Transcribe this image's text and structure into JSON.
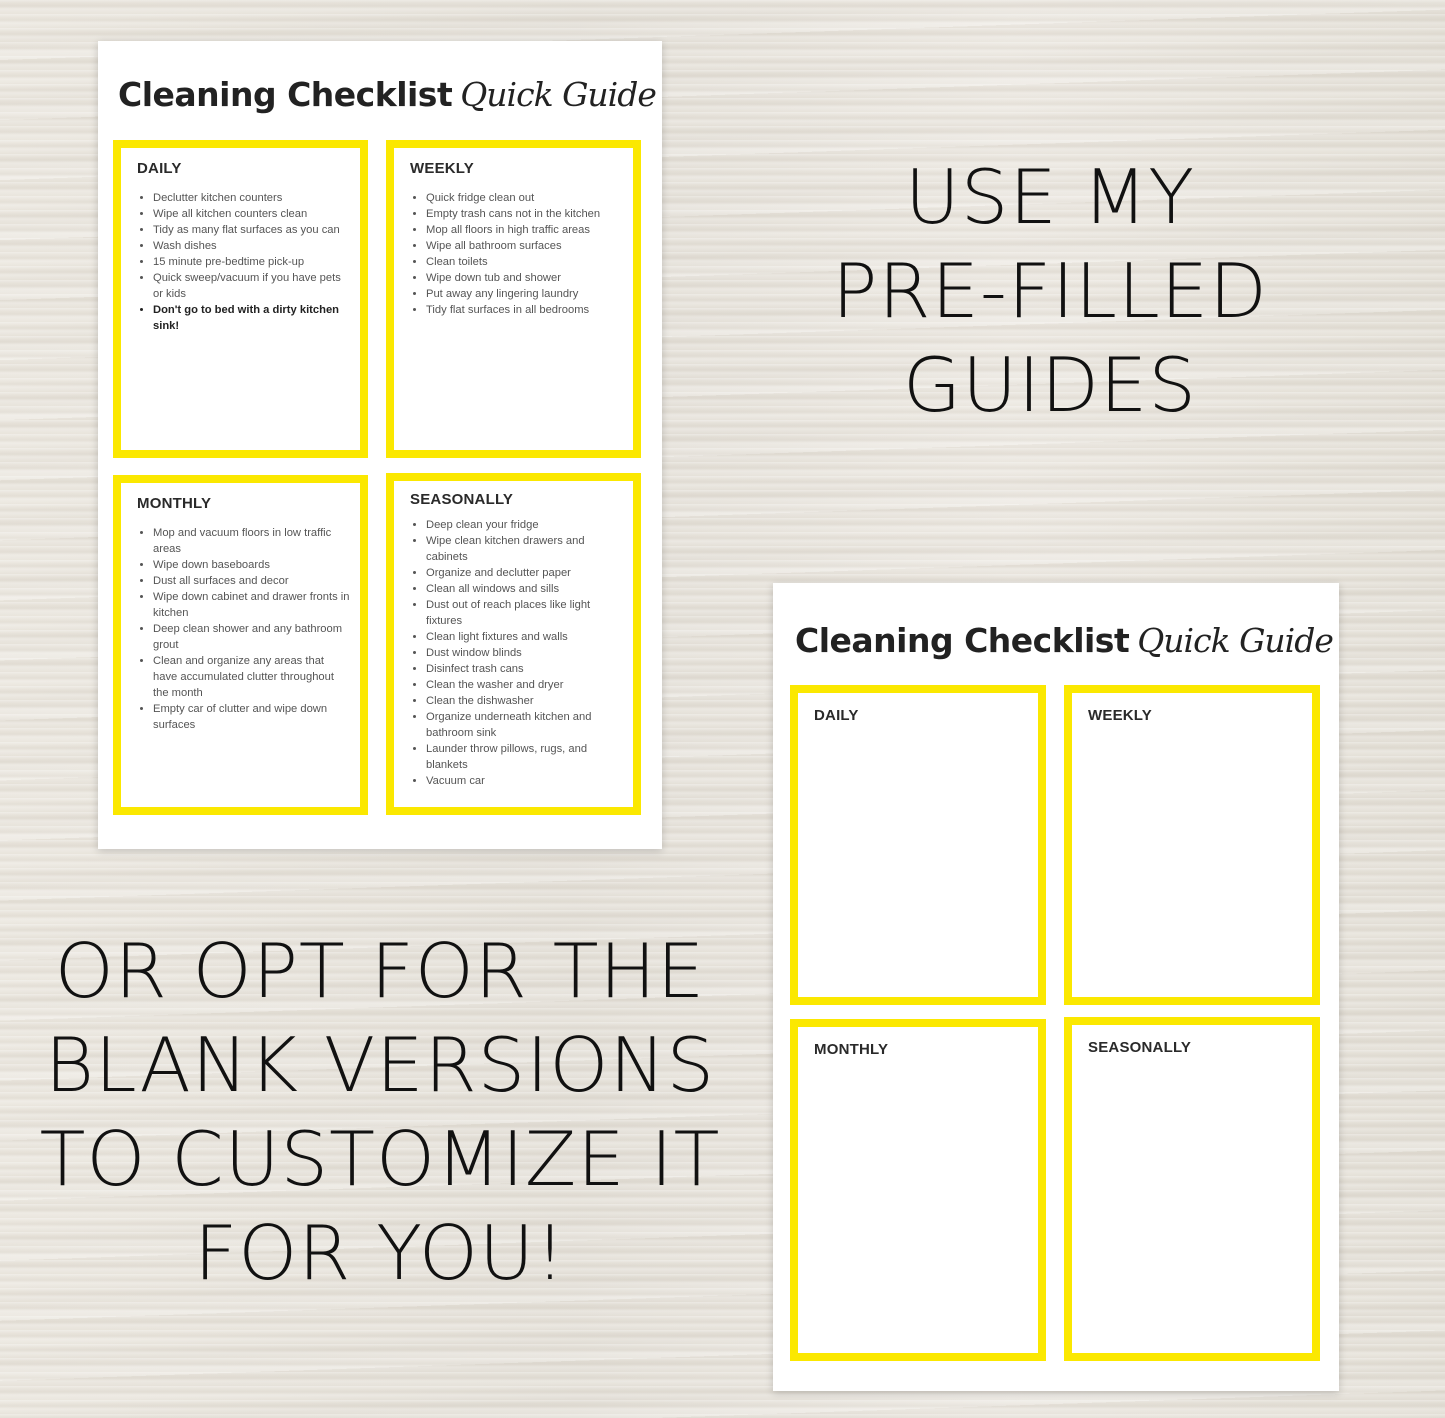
{
  "theme": {
    "accent_yellow": "#fbe800",
    "text_dark": "#222222",
    "text_body": "#555555"
  },
  "filled_sheet": {
    "title_bold": "Cleaning Checklist",
    "title_script": "Quick Guide",
    "sections": [
      {
        "title": "DAILY",
        "items": [
          "Declutter kitchen counters",
          "Wipe all kitchen counters clean",
          "Tidy as many flat surfaces as you can",
          "Wash dishes",
          "15 minute pre-bedtime pick-up",
          "Quick sweep/vacuum if you have pets or kids",
          "Don't go to bed with a dirty kitchen sink!"
        ]
      },
      {
        "title": "WEEKLY",
        "items": [
          "Quick fridge clean out",
          "Empty trash cans not in the kitchen",
          "Mop all floors in high traffic areas",
          "Wipe all bathroom surfaces",
          "Clean toilets",
          "Wipe down tub and shower",
          "Put away any lingering laundry",
          "Tidy flat surfaces in all bedrooms"
        ]
      },
      {
        "title": "MONTHLY",
        "items": [
          "Mop and vacuum floors in low traffic areas",
          "Wipe down baseboards",
          "Dust all surfaces and decor",
          "Wipe down cabinet and drawer fronts in kitchen",
          "Deep clean shower and any bathroom grout",
          "Clean and organize any areas that have accumulated clutter throughout the month",
          "Empty car of clutter and wipe down surfaces"
        ]
      },
      {
        "title": "SEASONALLY",
        "items": [
          "Deep clean your fridge",
          "Wipe clean kitchen drawers and cabinets",
          "Organize and declutter paper",
          "Clean all windows and sills",
          "Dust out of reach places like light fixtures",
          "Clean light fixtures and walls",
          "Dust window blinds",
          "Disinfect trash cans",
          "Clean the washer and dryer",
          "Clean the dishwasher",
          "Organize underneath kitchen and bathroom sink",
          "Launder throw pillows, rugs, and blankets",
          "Vacuum car"
        ]
      }
    ]
  },
  "blank_sheet": {
    "title_bold": "Cleaning Checklist",
    "title_script": "Quick Guide",
    "sections": [
      {
        "title": "DAILY"
      },
      {
        "title": "WEEKLY"
      },
      {
        "title": "MONTHLY"
      },
      {
        "title": "SEASONALLY"
      }
    ]
  },
  "headlines": {
    "top": [
      "USE MY",
      "PRE-FILLED",
      "GUIDES"
    ],
    "bottom": [
      "OR OPT FOR THE",
      "BLANK VERSIONS",
      "TO CUSTOMIZE IT",
      "FOR YOU!"
    ]
  }
}
